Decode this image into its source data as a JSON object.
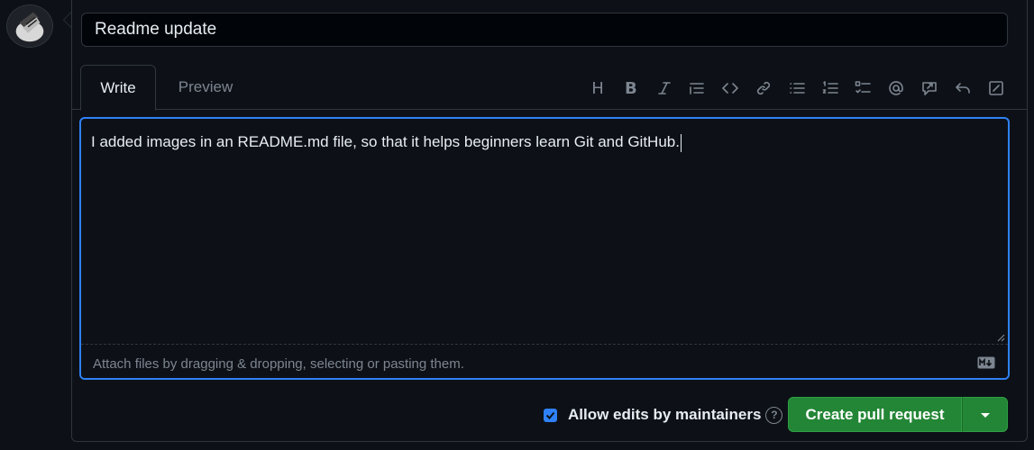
{
  "pr_title": "Readme update",
  "tabs": {
    "write": "Write",
    "preview": "Preview"
  },
  "toolbar": {
    "items": [
      "heading-icon",
      "bold-icon",
      "italic-icon",
      "quote-icon",
      "code-icon",
      "link-icon",
      "unordered-list-icon",
      "ordered-list-icon",
      "task-list-icon",
      "mention-icon",
      "reference-icon",
      "undo-icon",
      "fullscreen-icon"
    ],
    "heading_glyph": "H",
    "bold_glyph": "B"
  },
  "editor": {
    "body": "I added images in an README.md file, so that it helps beginners learn Git and GitHub.",
    "attach_hint": "Attach files by dragging & dropping, selecting or pasting them."
  },
  "footer": {
    "allow_edits_label": "Allow edits by maintainers",
    "allow_edits_checked": true,
    "help_glyph": "?",
    "create_button": "Create pull request"
  },
  "colors": {
    "accent": "#2f81f7",
    "primary_button": "#238636",
    "background": "#0d1117"
  }
}
